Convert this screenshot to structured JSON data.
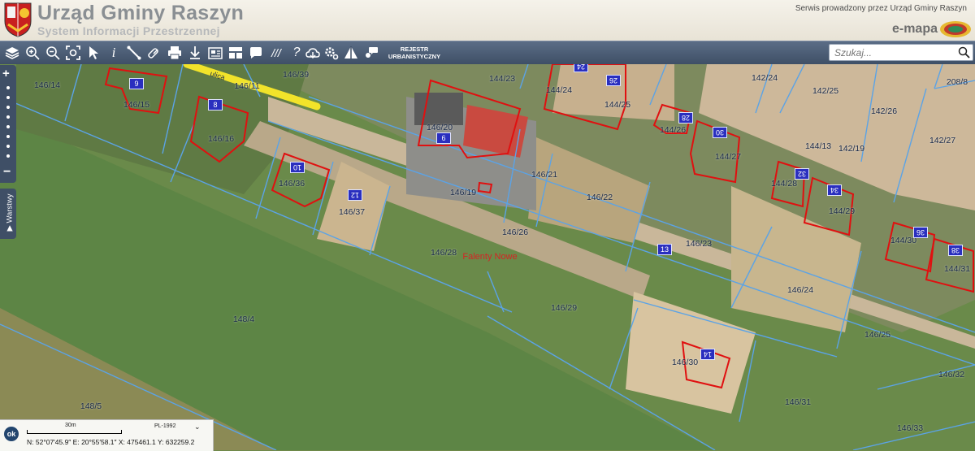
{
  "header": {
    "title": "Urząd Gminy Raszyn",
    "subtitle": "System Informacji Przestrzennej",
    "service_text": "Serwis prowadzony przez Urząd Gminy Raszyn",
    "brand": "e-mapa"
  },
  "toolbar": {
    "tools": [
      "layers-icon",
      "zoom-in-icon",
      "zoom-out-icon",
      "zoom-extent-icon",
      "select-pointer-icon",
      "info-icon",
      "measure-icon",
      "link-icon",
      "print-icon",
      "pin-icon",
      "export-icon",
      "layout-icon",
      "comment-icon",
      "hatch-icon",
      "help-icon",
      "cloud-icon",
      "settings-icon",
      "triangle-icon",
      "chat-icon"
    ],
    "rejestr_line1": "REJESTR",
    "rejestr_line2": "URBANISTYCZNY",
    "search_placeholder": "Szukaj..."
  },
  "map": {
    "street_label": "ulica",
    "locality": "Falenty Nowe",
    "parcels": [
      "146/14",
      "146/15",
      "146/11",
      "146/39",
      "146/16",
      "146/36",
      "146/37",
      "146/20",
      "146/21",
      "146/19",
      "146/22",
      "146/26",
      "146/28",
      "146/23",
      "146/29",
      "148/4",
      "148/5",
      "144/23",
      "144/24",
      "144/25",
      "144/26",
      "144/27",
      "142/24",
      "142/25",
      "142/26",
      "142/27",
      "208/8",
      "144/13",
      "142/19",
      "144/28",
      "144/29",
      "144/30",
      "144/31",
      "146/24",
      "146/25",
      "146/30",
      "146/31",
      "146/32",
      "146/33"
    ],
    "building_numbers": [
      "9",
      "8",
      "10",
      "12",
      "6",
      "24",
      "26",
      "28",
      "30",
      "32",
      "34",
      "36",
      "38",
      "13",
      "14"
    ],
    "colors": {
      "parcel_line": "#5ba3e6",
      "building_outline": "#e01010",
      "number_bg": "#2a2fbf"
    }
  },
  "side": {
    "layers_tab": "Warstwy"
  },
  "status": {
    "ok": "ok",
    "scale": "30m",
    "crs": "PL-1992",
    "coords": "N: 52°07′45.9″  E: 20°55′58.1″  X: 475461.1  Y: 632259.2"
  }
}
